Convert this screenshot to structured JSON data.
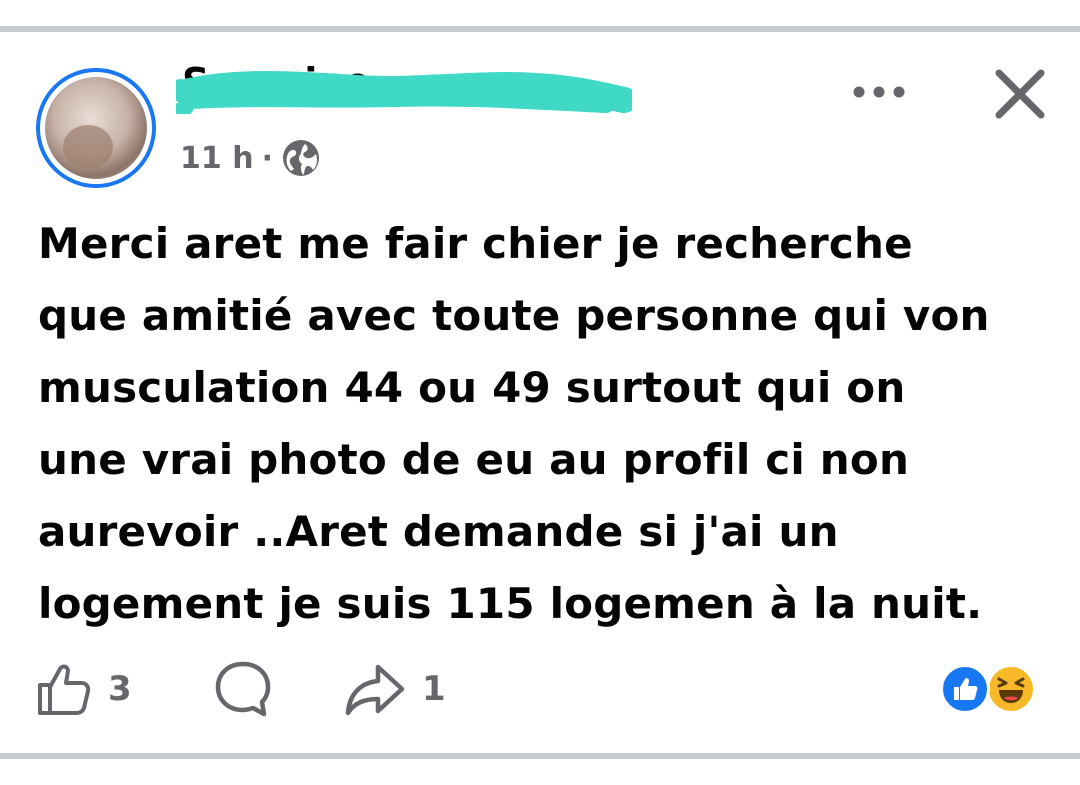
{
  "post": {
    "author": "Severine",
    "timestamp": "11 h",
    "separator": "·",
    "audience_icon": "globe-icon",
    "more_icon": "more-horizontal-icon",
    "close_icon": "close-icon",
    "text_lines": [
      "Merci aret me fair chier je recherche",
      "que amitié avec toute personne qui von",
      "musculation 44 ou 49 surtout qui on",
      "une vrai photo de eu au profil ci non",
      "aurevoir ..Aret demande si j'ai un",
      "logement je suis 115 logemen à la nuit."
    ]
  },
  "actions": {
    "like_icon": "thumbs-up-icon",
    "like_count": "3",
    "comment_icon": "comment-icon",
    "share_icon": "share-icon",
    "share_count": "1"
  },
  "reactions": [
    "like-reaction-icon",
    "haha-reaction-icon"
  ],
  "colors": {
    "brand_blue": "#1877f2",
    "redaction_teal": "#3fd9c6",
    "meta_gray": "#65676b",
    "divider_gray": "#c9ccd1",
    "haha_yellow": "#f7b928"
  }
}
